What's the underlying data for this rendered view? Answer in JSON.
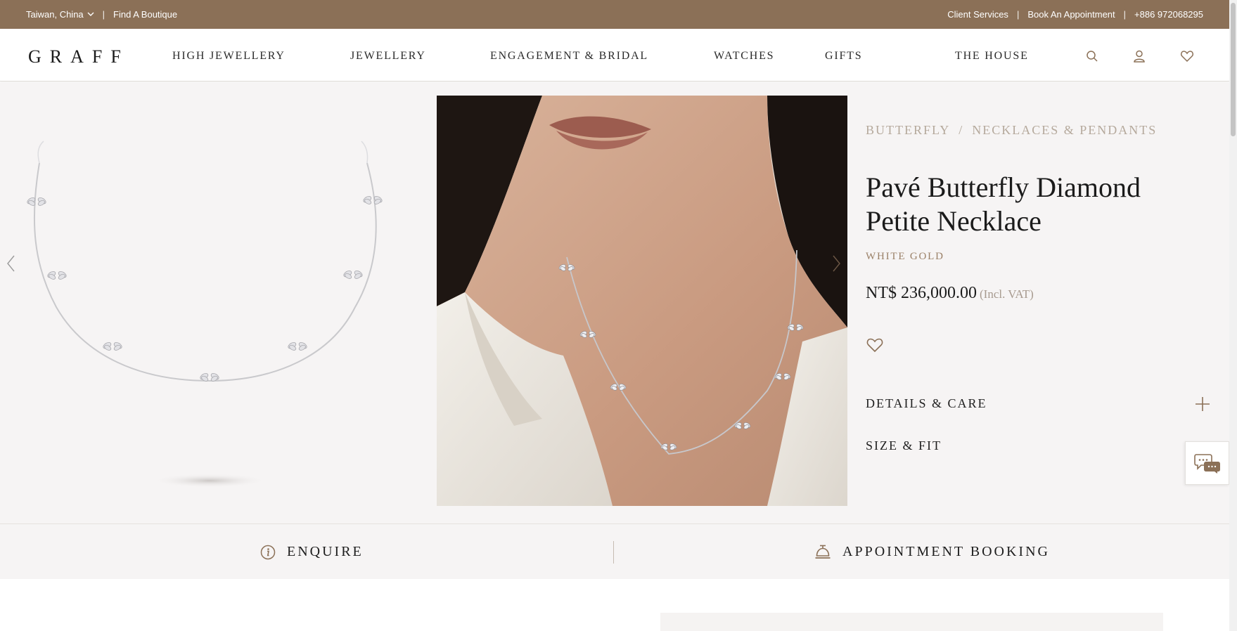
{
  "topbar": {
    "region": "Taiwan, China",
    "find_boutique": "Find A Boutique",
    "client_services": "Client Services",
    "book_appointment": "Book An Appointment",
    "phone": "+886 972068295",
    "separator": "|"
  },
  "nav": {
    "logo": "GRAFF",
    "items": [
      "HIGH JEWELLERY",
      "JEWELLERY",
      "ENGAGEMENT & BRIDAL",
      "WATCHES",
      "GIFTS",
      "THE HOUSE"
    ],
    "icons": [
      "search-icon",
      "account-icon",
      "wishlist-icon"
    ]
  },
  "product": {
    "breadcrumb": [
      "BUTTERFLY",
      "NECKLACES & PENDANTS"
    ],
    "breadcrumb_separator": "/",
    "title": "Pavé Butterfly Diamond Petite Necklace",
    "metal": "WHITE GOLD",
    "price": "NT$ 236,000.00",
    "vat_note": "(Incl. VAT)",
    "accordions": [
      "DETAILS & CARE",
      "SIZE & FIT"
    ]
  },
  "actions": {
    "enquire": "ENQUIRE",
    "appointment": "APPOINTMENT BOOKING"
  },
  "colors": {
    "brand_brown": "#8b7057",
    "accent_text": "#9b8168",
    "background": "#f6f4f4"
  }
}
